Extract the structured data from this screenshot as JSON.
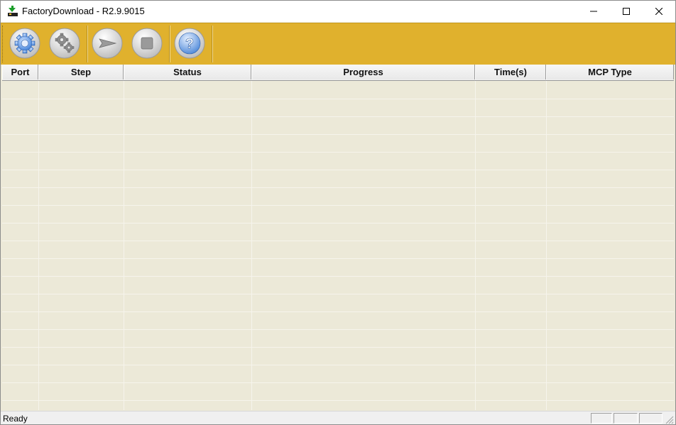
{
  "window": {
    "title": "FactoryDownload - R2.9.9015",
    "controls": [
      "minimize",
      "maximize",
      "close"
    ]
  },
  "toolbar": {
    "buttons": [
      {
        "name": "settings",
        "icon": "gear-icon"
      },
      {
        "name": "advanced-settings",
        "icon": "double-gear-icon"
      },
      {
        "name": "start",
        "icon": "play-arrow-icon"
      },
      {
        "name": "stop",
        "icon": "stop-square-icon"
      },
      {
        "name": "help",
        "icon": "question-mark-icon"
      }
    ],
    "background": "#e0b12d"
  },
  "table": {
    "columns": [
      "Port",
      "Step",
      "Status",
      "Progress",
      "Time(s)",
      "MCP Type"
    ],
    "rows": []
  },
  "statusbar": {
    "text": "Ready"
  }
}
